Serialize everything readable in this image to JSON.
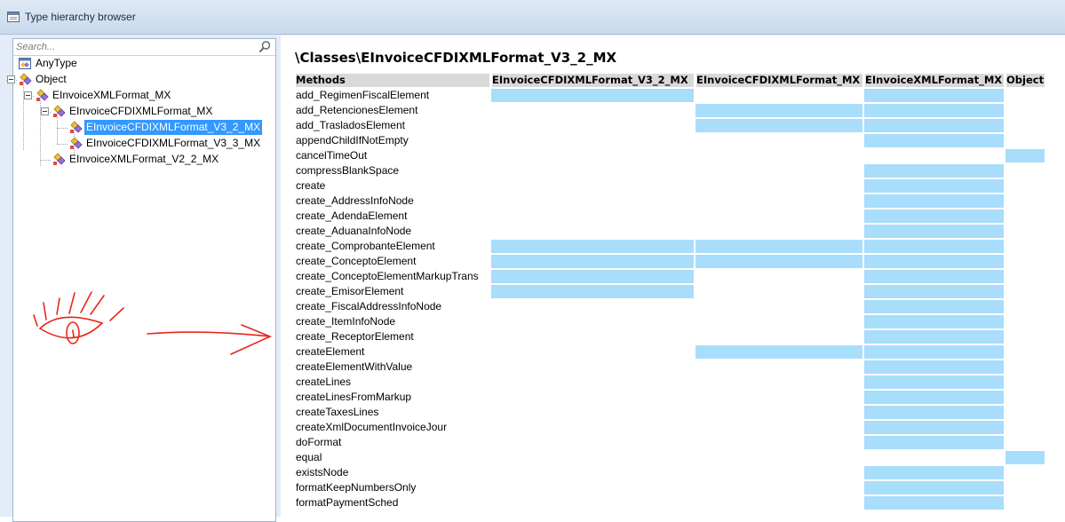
{
  "window": {
    "title": "Type hierarchy browser",
    "icon": "window-icon"
  },
  "search": {
    "placeholder": "Search...",
    "value": ""
  },
  "tree": {
    "nodes": [
      {
        "label": "AnyType",
        "icon": "anytype-icon",
        "expandable": false,
        "selected": false
      },
      {
        "label": "Object",
        "icon": "class-icon",
        "expandable": true,
        "selected": false
      },
      {
        "label": "EInvoiceXMLFormat_MX",
        "icon": "class-icon",
        "expandable": true,
        "selected": false
      },
      {
        "label": "EInvoiceCFDIXMLFormat_MX",
        "icon": "class-icon",
        "expandable": true,
        "selected": false
      },
      {
        "label": "EInvoiceCFDIXMLFormat_V3_2_MX",
        "icon": "class-icon",
        "expandable": false,
        "selected": true
      },
      {
        "label": "EInvoiceCFDIXMLFormat_V3_3_MX",
        "icon": "class-icon",
        "expandable": false,
        "selected": false
      },
      {
        "label": "EInvoiceXMLFormat_V2_2_MX",
        "icon": "class-icon",
        "expandable": false,
        "selected": false
      }
    ]
  },
  "main": {
    "path_title": "\\Classes\\EInvoiceCFDIXMLFormat_V3_2_MX",
    "methods_header": "Methods",
    "columns": [
      "EInvoiceCFDIXMLFormat_V3_2_MX",
      "EInvoiceCFDIXMLFormat_MX",
      "EInvoiceXMLFormat_MX",
      "Object"
    ],
    "highlight_color": "#a8ddfb",
    "rows": [
      {
        "method": "add_RegimenFiscalElement",
        "implemented_in": [
          true,
          false,
          true,
          false
        ]
      },
      {
        "method": "add_RetencionesElement",
        "implemented_in": [
          false,
          true,
          true,
          false
        ]
      },
      {
        "method": "add_TrasladosElement",
        "implemented_in": [
          false,
          true,
          true,
          false
        ]
      },
      {
        "method": "appendChildIfNotEmpty",
        "implemented_in": [
          false,
          false,
          true,
          false
        ]
      },
      {
        "method": "cancelTimeOut",
        "implemented_in": [
          false,
          false,
          false,
          true
        ]
      },
      {
        "method": "compressBlankSpace",
        "implemented_in": [
          false,
          false,
          true,
          false
        ]
      },
      {
        "method": "create",
        "implemented_in": [
          false,
          false,
          true,
          false
        ]
      },
      {
        "method": "create_AddressInfoNode",
        "implemented_in": [
          false,
          false,
          true,
          false
        ]
      },
      {
        "method": "create_AdendaElement",
        "implemented_in": [
          false,
          false,
          true,
          false
        ]
      },
      {
        "method": "create_AduanaInfoNode",
        "implemented_in": [
          false,
          false,
          true,
          false
        ]
      },
      {
        "method": "create_ComprobanteElement",
        "implemented_in": [
          true,
          true,
          true,
          false
        ]
      },
      {
        "method": "create_ConceptoElement",
        "implemented_in": [
          true,
          true,
          true,
          false
        ]
      },
      {
        "method": "create_ConceptoElementMarkupTrans",
        "implemented_in": [
          true,
          false,
          true,
          false
        ]
      },
      {
        "method": "create_EmisorElement",
        "implemented_in": [
          true,
          false,
          true,
          false
        ]
      },
      {
        "method": "create_FiscalAddressInfoNode",
        "implemented_in": [
          false,
          false,
          true,
          false
        ]
      },
      {
        "method": "create_ItemInfoNode",
        "implemented_in": [
          false,
          false,
          true,
          false
        ]
      },
      {
        "method": "create_ReceptorElement",
        "implemented_in": [
          false,
          false,
          true,
          false
        ]
      },
      {
        "method": "createElement",
        "implemented_in": [
          false,
          true,
          true,
          false
        ]
      },
      {
        "method": "createElementWithValue",
        "implemented_in": [
          false,
          false,
          true,
          false
        ]
      },
      {
        "method": "createLines",
        "implemented_in": [
          false,
          false,
          true,
          false
        ]
      },
      {
        "method": "createLinesFromMarkup",
        "implemented_in": [
          false,
          false,
          true,
          false
        ]
      },
      {
        "method": "createTaxesLines",
        "implemented_in": [
          false,
          false,
          true,
          false
        ]
      },
      {
        "method": "createXmlDocumentInvoiceJour",
        "implemented_in": [
          false,
          false,
          true,
          false
        ]
      },
      {
        "method": "doFormat",
        "implemented_in": [
          false,
          false,
          true,
          false
        ]
      },
      {
        "method": "equal",
        "implemented_in": [
          false,
          false,
          false,
          true
        ]
      },
      {
        "method": "existsNode",
        "implemented_in": [
          false,
          false,
          true,
          false
        ]
      },
      {
        "method": "formatKeepNumbersOnly",
        "implemented_in": [
          false,
          false,
          true,
          false
        ]
      },
      {
        "method": "formatPaymentSched",
        "implemented_in": [
          false,
          false,
          true,
          false
        ]
      }
    ]
  },
  "annotation": {
    "icons": [
      "eye-icon",
      "arrow-right-icon"
    ],
    "color": "#e8261c"
  }
}
